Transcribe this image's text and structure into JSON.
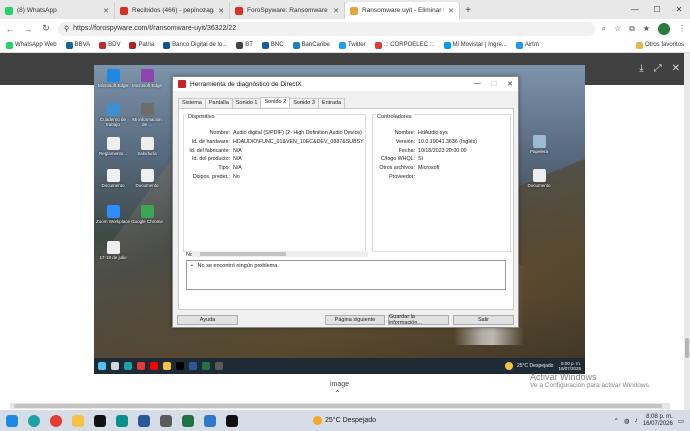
{
  "browser": {
    "tabs": [
      {
        "title": "(8) WhatsApp",
        "color": "#25d366"
      },
      {
        "title": "Recibidos (466) - pepinozaga@gm",
        "color": "#d93025"
      },
      {
        "title": "ForoSpyware: Ransomware .uyit -",
        "color": "#d93025"
      },
      {
        "title": "Ransomware uyit - Eliminar Malwa",
        "color": "#e8a33a",
        "active": true
      }
    ],
    "url": "https://forospyware.com/t/ransomware-uyit/36322/22",
    "bookmarks": [
      {
        "label": "WhatsApp Web",
        "color": "#25d366"
      },
      {
        "label": "BBVA",
        "color": "#1464a5"
      },
      {
        "label": "BDV",
        "color": "#c62828"
      },
      {
        "label": "Patria",
        "color": "#b22222"
      },
      {
        "label": "Banco Digital de lo...",
        "color": "#0b5394"
      },
      {
        "label": "BT",
        "color": "#444444"
      },
      {
        "label": "BNC",
        "color": "#1a5e9a"
      },
      {
        "label": "BanCaribe",
        "color": "#1d7fc4"
      },
      {
        "label": "Twitter",
        "color": "#1da1f2"
      },
      {
        "label": ".:: CORPOELEC ::.",
        "color": "#e53935"
      },
      {
        "label": "Mi Movistar | Ingre...",
        "color": "#019df4"
      },
      {
        "label": "Airtm",
        "color": "#2196f3"
      }
    ],
    "other_bookmarks": "Otros favoritos"
  },
  "desktop_icons": [
    {
      "label": "Microsoft Edge",
      "color": "#1e88e5"
    },
    {
      "label": "Microsoft Edge",
      "color": "#8e44ad"
    },
    {
      "label": "Cuaderno de trabajo",
      "color": "#3d8fd1"
    },
    {
      "label": "Mi información de ...",
      "color": "#6d6d6d"
    },
    {
      "label": "Reglamento...",
      "color": "#eeeeee"
    },
    {
      "label": "Sabiduría",
      "color": "#eeeeee"
    },
    {
      "label": "Documento",
      "color": "#f0f0f0"
    },
    {
      "label": "Documento",
      "color": "#f0f0f0"
    },
    {
      "label": "Zoom Workplace",
      "color": "#2d8cff"
    },
    {
      "label": "Google Chrome",
      "color": "#3aa757"
    },
    {
      "label": "17-18 de julio",
      "color": "#eeeeee"
    },
    {
      "label": "Papelera",
      "color": "#9bbbd4"
    },
    {
      "label": "Documento",
      "color": "#eeeeee"
    }
  ],
  "dxdiag": {
    "title": "Herramienta de diagnóstico de DirectX",
    "tabs": [
      "Sistema",
      "Pantalla",
      "Sonido 1",
      "Sonido 2",
      "Sonido 3",
      "Entrada"
    ],
    "selected_tab": "Sonido 2",
    "device": {
      "group": "Dispositivo",
      "rows": [
        {
          "key": "Nombre:",
          "value": "Audio digital (S/PDIF) (2- High Definition Audio Device)"
        },
        {
          "key": "Id. de hardware:",
          "value": "HDAUDIO\\FUNC_01&VEN_10EC&DEV_0887&SUBSYS_1043"
        },
        {
          "key": "Id. del fabricante:",
          "value": "N/A"
        },
        {
          "key": "Id. del producto:",
          "value": "N/A"
        },
        {
          "key": "Tipo:",
          "value": "N/A"
        },
        {
          "key": "Dispos. predet.:",
          "value": "No"
        }
      ]
    },
    "drivers": {
      "group": "Controladores",
      "rows": [
        {
          "key": "Nombre:",
          "value": "HdAudio.sys"
        },
        {
          "key": "Versión:",
          "value": "10.0.19041.3636 (Inglés)"
        },
        {
          "key": "Fecha:",
          "value": "10/18/2023 20:00:00"
        },
        {
          "key": "C/logo WHQL:",
          "value": "Sí"
        },
        {
          "key": "Otros archivos:",
          "value": ""
        },
        {
          "key": "Proveedor:",
          "value": "Microsoft"
        }
      ]
    },
    "notes_title": "Notas",
    "notes_text": "No se encontró ningún problema.",
    "buttons": {
      "help": "Ayuda",
      "next": "Página siguiente",
      "save": "Guardar la información...",
      "exit": "Salir"
    }
  },
  "inner_taskbar": {
    "weather": "25°C  Despejado",
    "time": "8:00 p. m.",
    "date": "16/07/2026"
  },
  "image_caption": "image",
  "activation": {
    "title": "Activar Windows",
    "subtitle": "Ve a Configuración para activar Windows."
  },
  "taskbar": {
    "icons": [
      {
        "name": "windows-start-icon",
        "color": "#1e88e5"
      },
      {
        "name": "edge-icon",
        "color": "#1ba1a6"
      },
      {
        "name": "chrome-icon",
        "color": "#e53935"
      },
      {
        "name": "file-explorer-icon",
        "color": "#f5c242"
      },
      {
        "name": "tiktok-icon",
        "color": "#111111"
      },
      {
        "name": "edge-dev-icon",
        "color": "#0a8f8b"
      },
      {
        "name": "word-icon",
        "color": "#2b579a"
      },
      {
        "name": "email-icon",
        "color": "#5b5b5b"
      },
      {
        "name": "excel-icon",
        "color": "#217346"
      },
      {
        "name": "onedrive-icon",
        "color": "#2f79c9"
      },
      {
        "name": "directx-icon",
        "color": "#111111"
      }
    ],
    "weather": "25°C  Despejado",
    "time": "8:08 p. m.",
    "date": "16/07/2026"
  }
}
